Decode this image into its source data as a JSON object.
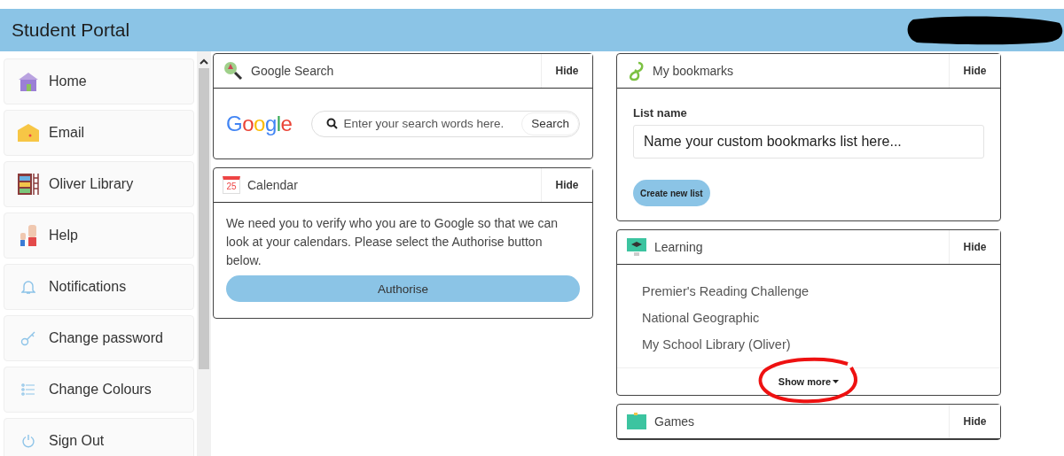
{
  "header": {
    "title": "Student Portal"
  },
  "sidebar": {
    "items": [
      {
        "label": "Home"
      },
      {
        "label": "Email"
      },
      {
        "label": "Oliver Library"
      },
      {
        "label": "Help"
      },
      {
        "label": "Notifications"
      },
      {
        "label": "Change password"
      },
      {
        "label": "Change Colours"
      },
      {
        "label": "Sign Out"
      }
    ]
  },
  "columns": [
    [
      {
        "kind": "search",
        "title": "Google Search",
        "hide": "Hide",
        "logo": "Google",
        "placeholder": "Enter your search words here.",
        "button": "Search"
      },
      {
        "kind": "calendar",
        "title": "Calendar",
        "hide": "Hide",
        "icon_text": "25",
        "message": "We need you to verify who you are to Google so that we can look at your calendars. Please select the Authorise button below.",
        "button": "Authorise"
      }
    ],
    [
      {
        "kind": "bookmarks",
        "title": "My bookmarks",
        "hide": "Hide",
        "field_label": "List name",
        "placeholder": "Name your custom bookmarks list here...",
        "button": "Create new list"
      },
      {
        "kind": "links",
        "title": "Learning",
        "hide": "Hide",
        "links": [
          "Premier's Reading Challenge",
          "National Geographic",
          "My School Library (Oliver)"
        ],
        "more": "Show more"
      },
      {
        "kind": "links",
        "title": "Games",
        "hide": "Hide"
      }
    ]
  ]
}
